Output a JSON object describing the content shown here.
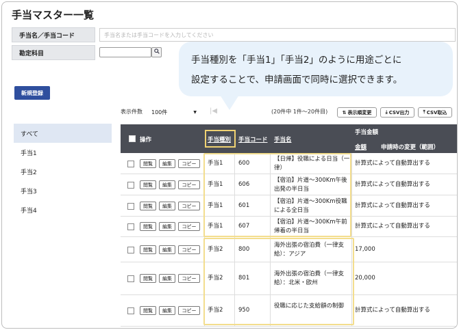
{
  "page": {
    "title": "手当マスター一覧"
  },
  "filters": {
    "name_code_label": "手当名／手当コード",
    "search_placeholder": "手当名または手当コードを入力してください",
    "subject_label": "勘定科目",
    "subject_value": ""
  },
  "actions": {
    "new_label": "新規登録"
  },
  "tooltip": {
    "line1": "手当種別を「手当1」「手当2」のように用途ごとに",
    "line2": "設定することで、申請画面で同時に選択できます。"
  },
  "pager": {
    "per_page_label": "表示件数",
    "per_page_value": "100件",
    "info": "(20件中 1件～20件目)"
  },
  "toolbar": {
    "display_order": "表示順変更",
    "csv_export": "CSV出力",
    "csv_import": "CSV取込"
  },
  "sidebar": {
    "items": [
      {
        "label": "すべて"
      },
      {
        "label": "手当1"
      },
      {
        "label": "手当2"
      },
      {
        "label": "手当3"
      },
      {
        "label": "手当4"
      }
    ]
  },
  "table": {
    "headers": {
      "operation": "操作",
      "type": "手当種別",
      "code": "手当コード",
      "name": "手当名",
      "amount_group": "手当金額",
      "amount": "金額",
      "change_on_apply": "申請時の変更（範囲）"
    },
    "row_buttons": {
      "view": "閲覧",
      "edit": "編集",
      "copy": "コピー"
    },
    "rows": [
      {
        "type": "手当1",
        "code": "600",
        "name": "【日帰】役職による日当（一律）",
        "amount": "計算式によって自動算出する"
      },
      {
        "type": "手当1",
        "code": "606",
        "name": "【宿泊】片道～300Km午後出発の半日当",
        "amount": "計算式によって自動算出する"
      },
      {
        "type": "手当1",
        "code": "601",
        "name": "【宿泊】片道～300Km役職による全日当",
        "amount": "計算式によって自動算出する"
      },
      {
        "type": "手当1",
        "code": "607",
        "name": "【宿泊】片道～300Km午前帰着の半日当",
        "amount": "計算式によって自動算出する"
      },
      {
        "type": "手当2",
        "code": "800",
        "name": "海外出張の宿泊費（一律支給）：アジア",
        "amount": "17,000"
      },
      {
        "type": "手当2",
        "code": "801",
        "name": "海外出張の宿泊費（一律支給）：北米・欧州",
        "amount": "20,000"
      },
      {
        "type": "手当2",
        "code": "950",
        "name": "役職に応じた支給額の制御",
        "amount": "計算式によって自動算出する"
      }
    ]
  },
  "colors": {
    "header_bg": "#4a4d55",
    "primary_button": "#2f4f9e",
    "highlight": "#f3dd8d",
    "tooltip_bg": "#e8f2fb"
  }
}
